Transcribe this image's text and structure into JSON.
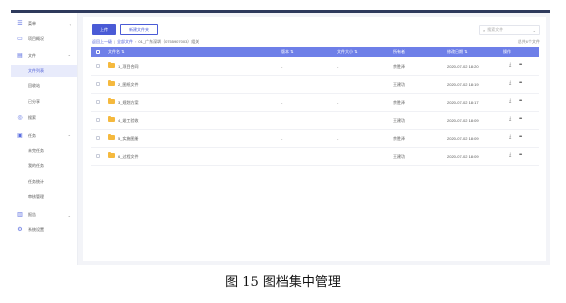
{
  "sidebar": {
    "items": [
      {
        "icon": "list-icon",
        "label": "菜单",
        "arrow": "‹"
      },
      {
        "icon": "monitor-icon",
        "label": "项目概况",
        "arrow": ""
      },
      {
        "icon": "file-icon",
        "label": "文件",
        "arrow": "⌃"
      },
      {
        "icon": "",
        "label": "文件列表",
        "arrow": "",
        "sub": true,
        "active": true
      },
      {
        "icon": "",
        "label": "回收站",
        "arrow": "",
        "sub": true
      },
      {
        "icon": "",
        "label": "已分享",
        "arrow": "",
        "sub": true
      },
      {
        "icon": "search-circle-icon",
        "label": "搜索",
        "arrow": ""
      },
      {
        "icon": "task-icon",
        "label": "任务",
        "arrow": "⌃"
      },
      {
        "icon": "",
        "label": "未完任务",
        "arrow": "",
        "sub": true
      },
      {
        "icon": "",
        "label": "我的任务",
        "arrow": "",
        "sub": true
      },
      {
        "icon": "",
        "label": "任务统计",
        "arrow": "",
        "sub": true
      },
      {
        "icon": "",
        "label": "审核管理",
        "arrow": "",
        "sub": true
      },
      {
        "icon": "chart-icon",
        "label": "报告",
        "arrow": "⌄"
      },
      {
        "icon": "gear-icon",
        "label": "系统设置",
        "arrow": ""
      }
    ]
  },
  "toolbar": {
    "upload_label": "上传",
    "new_folder_label": "新建文件夹"
  },
  "search": {
    "placeholder": "搜索文件",
    "dropdown": "⌄"
  },
  "breadcrumb": {
    "back": "返回上一级",
    "root": "全部文件",
    "current": "01_广东深圳（0755907003）组关"
  },
  "total_text": "总共6个文件",
  "table": {
    "headers": [
      "文件名 ⇅",
      "版本 ⇅",
      "文件大小 ⇅",
      "所有者",
      "修改日期 ⇅",
      "操作"
    ],
    "rows": [
      {
        "name": "1_项目合同",
        "version": "-",
        "size": "-",
        "owner": "余胜泽",
        "date": "2020-07-02 18:20"
      },
      {
        "name": "2_图纸文件",
        "version": "",
        "size": "",
        "owner": "王建功",
        "date": "2020-07-02 18:19"
      },
      {
        "name": "3_规划方案",
        "version": "-",
        "size": "-",
        "owner": "余胜泽",
        "date": "2020-07-02 18:17"
      },
      {
        "name": "4_竣工验收",
        "version": "",
        "size": "",
        "owner": "王建功",
        "date": "2020-07-02 18:09"
      },
      {
        "name": "5_实施图册",
        "version": "-",
        "size": "-",
        "owner": "余胜泽",
        "date": "2020-07-02 18:09"
      },
      {
        "name": "6_过程文件",
        "version": "",
        "size": "",
        "owner": "王建功",
        "date": "2020-07-02 18:09"
      }
    ],
    "action_download": "⤓",
    "action_more": "•••"
  },
  "caption": "图 15  图档集中管理"
}
